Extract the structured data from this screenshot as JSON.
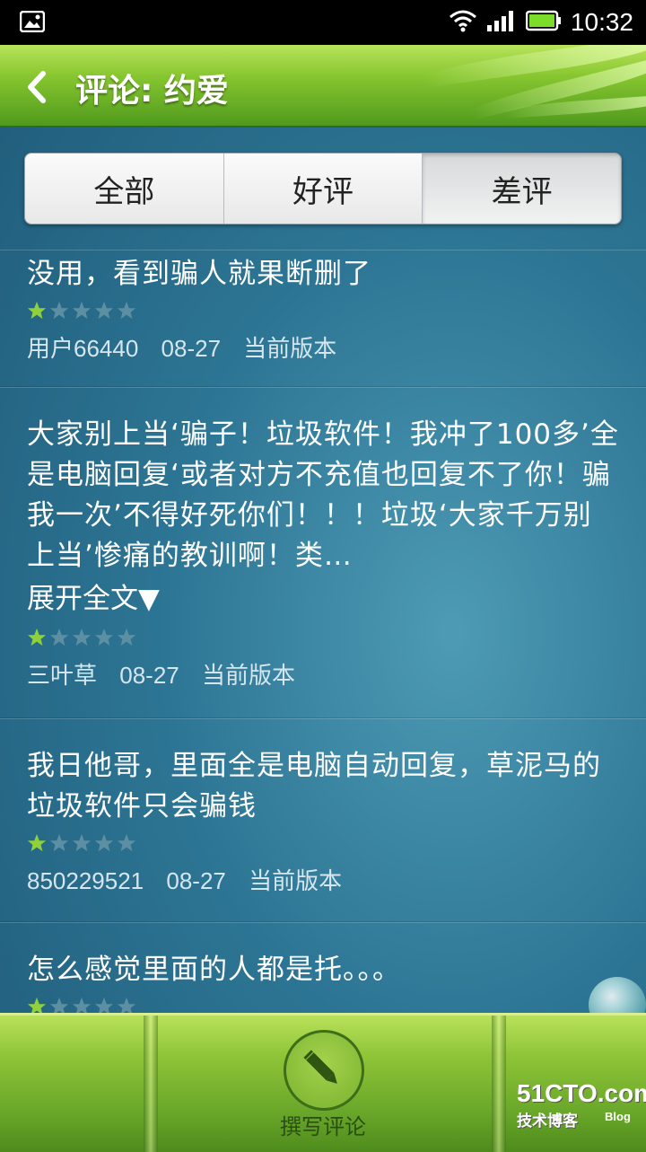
{
  "status_bar": {
    "time": "10:32"
  },
  "header": {
    "title": "评论: 约爱"
  },
  "tabs": [
    {
      "label": "全部",
      "selected": false
    },
    {
      "label": "好评",
      "selected": false
    },
    {
      "label": "差评",
      "selected": true
    }
  ],
  "reviews": [
    {
      "text": "没用，看到骗人就果断删了",
      "rating": 1,
      "user": "用户66440",
      "date": "08-27",
      "version": "当前版本"
    },
    {
      "text": "大家别上当‘骗子！垃圾软件！我冲了100多’全是电脑回复‘或者对方不充值也回复不了你！骗我一次’不得好死你们！！！垃圾‘大家千万别上当’惨痛的教训啊！类…",
      "expand_label": "展开全文▼",
      "rating": 1,
      "user": "三叶草",
      "date": "08-27",
      "version": "当前版本"
    },
    {
      "text": "我日他哥，里面全是电脑自动回复，草泥马的垃圾软件只会骗钱",
      "rating": 1,
      "user": "850229521",
      "date": "08-27",
      "version": "当前版本"
    },
    {
      "text": "怎么感觉里面的人都是托。。。",
      "rating": 1
    }
  ],
  "bottom": {
    "write_label": "撰写评论"
  },
  "watermark": {
    "main": "51CTO.com",
    "sub": "技术博客",
    "blog": "Blog"
  },
  "colors": {
    "star_active": "#8fd13a",
    "star_inactive": "#5d8fa2"
  },
  "icons": [
    "image-icon",
    "wifi-icon",
    "signal-icon",
    "battery-icon",
    "back-arrow-icon",
    "star-icon",
    "pencil-icon"
  ]
}
